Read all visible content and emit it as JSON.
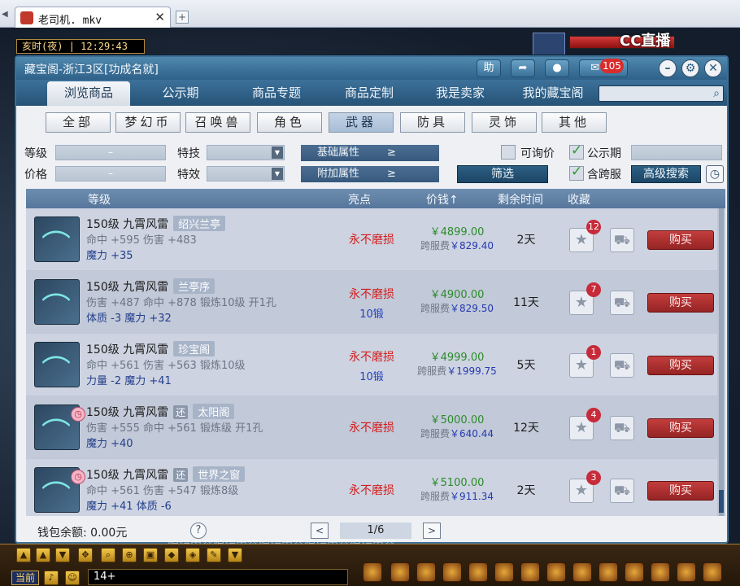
{
  "player": {
    "tab_title": "老司机. mkv",
    "tab_close": "✕",
    "new_tab": "+"
  },
  "game": {
    "clock": "亥时(夜) | 12:29:43",
    "cc_logo": "CC直播"
  },
  "dialog": {
    "title": "藏宝阁-浙江3区[功成名就]",
    "toolbar": {
      "help_label": "助",
      "message_count": "105"
    },
    "nav_tabs": [
      "浏览商品",
      "公示期",
      "商品专题",
      "商品定制",
      "我是卖家",
      "我的藏宝阁"
    ],
    "active_nav_tab": 0,
    "categories": [
      "全部",
      "梦幻币",
      "召唤兽",
      "角色",
      "武器",
      "防具",
      "灵饰",
      "其他"
    ],
    "active_category": 4,
    "filters": {
      "level_label": "等级",
      "level_value": "–",
      "price_label": "价格",
      "price_value": "–",
      "skill_label": "特技",
      "effect_label": "特效",
      "base_attr": "基础属性",
      "extra_attr": "附加属性",
      "ge": "≥",
      "inquiry_label": "可询价",
      "publicity_label": "公示期",
      "cross_server_label": "含跨服",
      "filter_button": "筛选",
      "advanced_search_button": "高级搜索"
    },
    "table_headers": [
      "等级",
      "亮点",
      "价钱↑",
      "剩余时间",
      "收藏"
    ],
    "items": [
      {
        "name": "150级 九霄风雷",
        "returned": false,
        "server": "绍兴兰亭",
        "attr_line2": "命中 +595 伤害 +483",
        "attr_line3": "魔力 +35",
        "highlight": "永不磨损",
        "highlight2": "",
        "price": "￥4899.00",
        "cross_fee_label": "跨服费",
        "cross_fee": "￥829.40",
        "remaining": "2天",
        "fav_count": "12",
        "buy_label": "购买"
      },
      {
        "name": "150级 九霄风雷",
        "returned": false,
        "server": "兰亭序",
        "attr_line2": "伤害 +487 命中 +878 锻炼10级 开1孔",
        "attr_line3": "体质 -3 魔力 +32",
        "highlight": "永不磨损",
        "highlight2": "10锻",
        "price": "￥4900.00",
        "cross_fee_label": "跨服费",
        "cross_fee": "￥829.50",
        "remaining": "11天",
        "fav_count": "7",
        "buy_label": "购买"
      },
      {
        "name": "150级 九霄风雷",
        "returned": false,
        "server": "珍宝阁",
        "attr_line2": "命中 +561 伤害 +563 锻炼10级",
        "attr_line3": "力量 -2 魔力 +41",
        "highlight": "永不磨损",
        "highlight2": "10锻",
        "price": "￥4999.00",
        "cross_fee_label": "跨服费",
        "cross_fee": "￥1999.75",
        "remaining": "5天",
        "fav_count": "1",
        "buy_label": "购买"
      },
      {
        "name": "150级 九霄风雷",
        "returned": true,
        "return_tag": "还",
        "server": "太阳阁",
        "attr_line2": "伤害 +555 命中 +561 锻炼级 开1孔",
        "attr_line3": "魔力 +40",
        "highlight": "永不磨损",
        "highlight2": "",
        "price": "￥5000.00",
        "cross_fee_label": "跨服费",
        "cross_fee": "￥640.44",
        "remaining": "12天",
        "fav_count": "4",
        "buy_label": "购买"
      },
      {
        "name": "150级 九霄风雷",
        "returned": true,
        "return_tag": "还",
        "server": "世界之窗",
        "attr_line2": "命中 +561 伤害 +547 锻炼8级",
        "attr_line3": "魔力 +41 体质 -6",
        "highlight": "永不磨损",
        "highlight2": "",
        "price": "￥5100.00",
        "cross_fee_label": "跨服费",
        "cross_fee": "￥911.34",
        "remaining": "2天",
        "fav_count": "3",
        "buy_label": "购买"
      }
    ],
    "footer": {
      "wallet": "钱包余额: 0.00元",
      "help": "?",
      "page": "1/6",
      "prev": "<",
      "next": ">"
    }
  },
  "overlay_text": "编辑内容编辑内容编辑内容编辑内容编辑内容",
  "hud": {
    "channel": "当前",
    "chat_input": "14+"
  }
}
